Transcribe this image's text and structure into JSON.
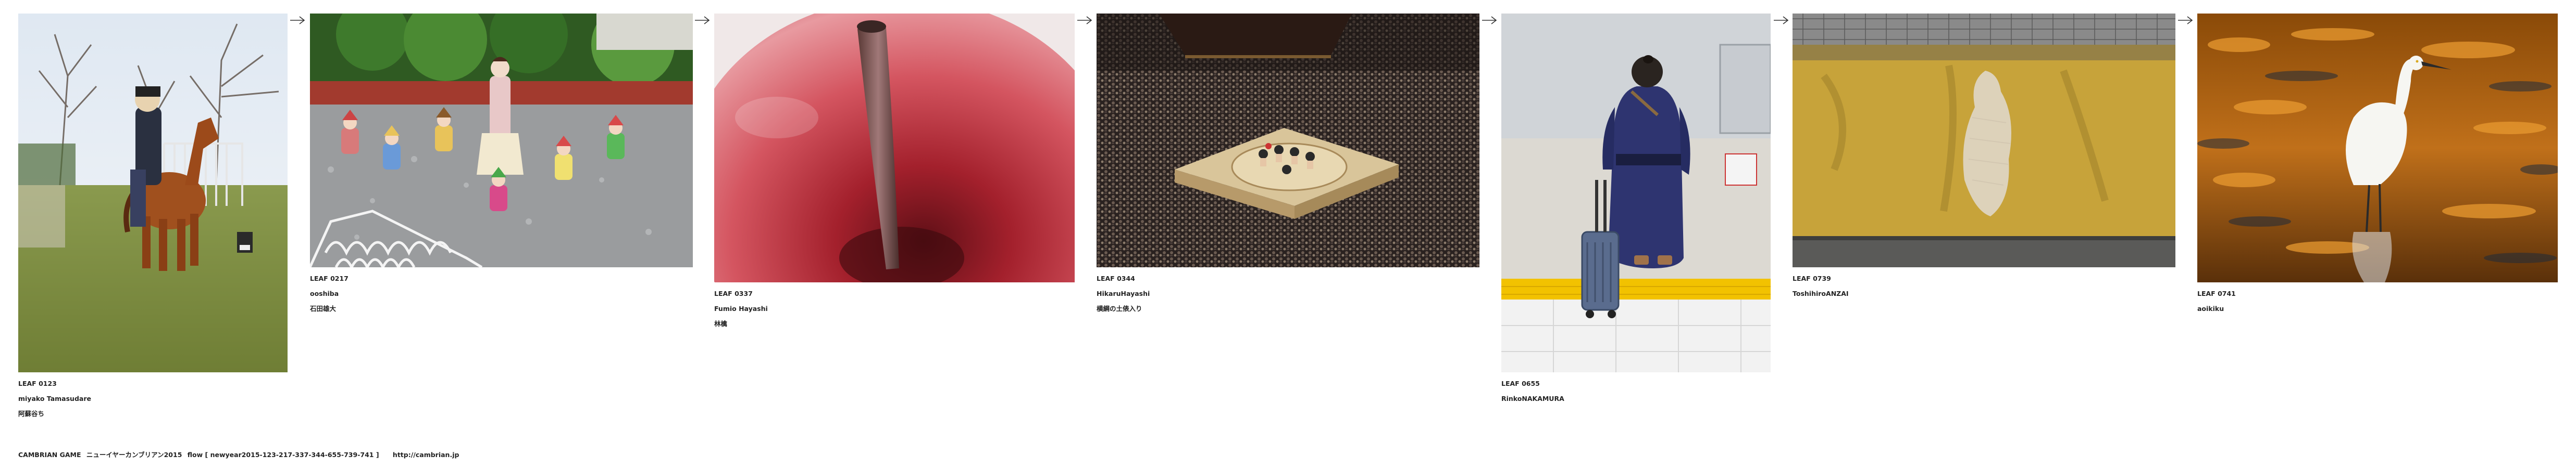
{
  "leaves": [
    {
      "id": "LEAF 0123",
      "author": "miyako Tamasudare",
      "title": "阿蘇谷ち",
      "subject": "horse-statue-photo"
    },
    {
      "id": "LEAF 0217",
      "author": "ooshiba",
      "title": "石田雄大",
      "subject": "garden-figurines-photo"
    },
    {
      "id": "LEAF 0337",
      "author": "Fumio Hayashi",
      "title": "林檎",
      "subject": "apple-closeup-photo"
    },
    {
      "id": "LEAF 0344",
      "author": "HikaruHayashi",
      "title": "横綱の土俵入り",
      "subject": "sumo-arena-photo"
    },
    {
      "id": "LEAF 0655",
      "author": "RinkoNAKAMURA",
      "title": "",
      "subject": "sumo-wrestler-station-photo"
    },
    {
      "id": "LEAF 0739",
      "author": "ToshihiroANZAI",
      "title": "",
      "subject": "yellow-wall-photo"
    },
    {
      "id": "LEAF 0741",
      "author": "aoikiku",
      "title": "",
      "subject": "white-egret-photo"
    }
  ],
  "footer": {
    "brand": "CAMBRIAN GAME",
    "event": "ニューイヤーカンブリアン2015",
    "flow": "flow [ newyear2015-123-217-337-344-655-739-741 ]",
    "url": "http://cambrian.jp"
  }
}
